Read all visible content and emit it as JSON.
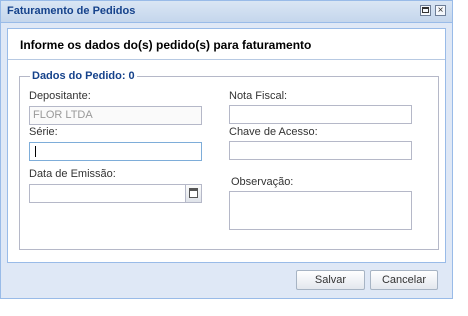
{
  "window": {
    "title": "Faturamento de Pedidos",
    "close_glyph": "×"
  },
  "header": {
    "text": "Informe os dados do(s) pedido(s) para faturamento"
  },
  "group": {
    "legend": "Dados do Pedido: 0"
  },
  "fields": {
    "depositante": {
      "label": "Depositante:",
      "value": "FLOR LTDA"
    },
    "nota_fiscal": {
      "label": "Nota Fiscal:",
      "value": ""
    },
    "serie": {
      "label": "Série:",
      "value": ""
    },
    "chave_acesso": {
      "label": "Chave de Acesso:",
      "value": ""
    },
    "data_emissao": {
      "label": "Data de Emissão:",
      "value": ""
    },
    "observacao": {
      "label": "Observação:",
      "value": ""
    }
  },
  "buttons": {
    "save": "Salvar",
    "cancel": "Cancelar"
  },
  "icons": {
    "maximize": "maximize-icon",
    "close": "close-icon",
    "calendar": "calendar-icon"
  }
}
